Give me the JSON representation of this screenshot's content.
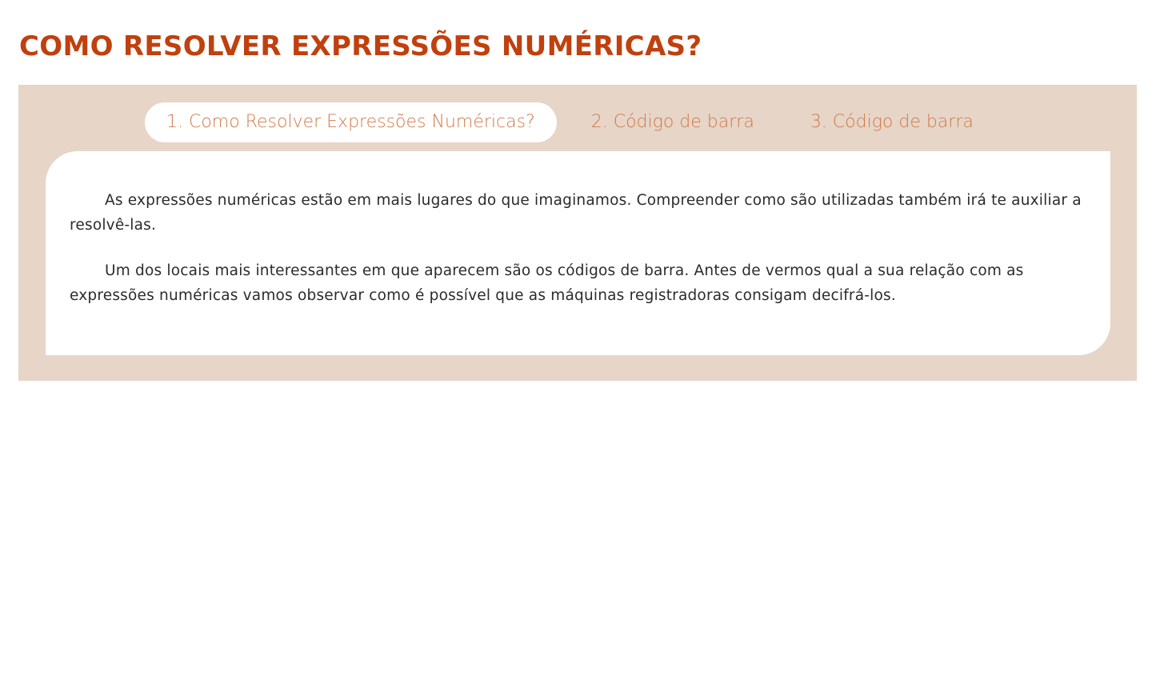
{
  "page": {
    "title": "COMO RESOLVER EXPRESSÕES NUMÉRICAS?"
  },
  "tabs": [
    {
      "label": "1. Como Resolver Expressões Numéricas?",
      "active": true
    },
    {
      "label": "2. Código de barra",
      "active": false
    },
    {
      "label": "3. Código de barra",
      "active": false
    }
  ],
  "content": {
    "paragraphs": [
      "As expressões numéricas estão em mais lugares do que imaginamos. Compreender como são utilizadas também irá te auxiliar a resolvê-las.",
      "Um dos locais mais interessantes em que aparecem são os códigos de barra. Antes de vermos qual a sua relação com as expressões numéricas vamos observar como é possível que as máquinas registradoras consigam decifrá-los."
    ]
  },
  "colors": {
    "title": "#c0400e",
    "panel_background": "#e7d5c8",
    "tab_text": "#cf7a4a",
    "body_text": "#2b2b2b"
  }
}
